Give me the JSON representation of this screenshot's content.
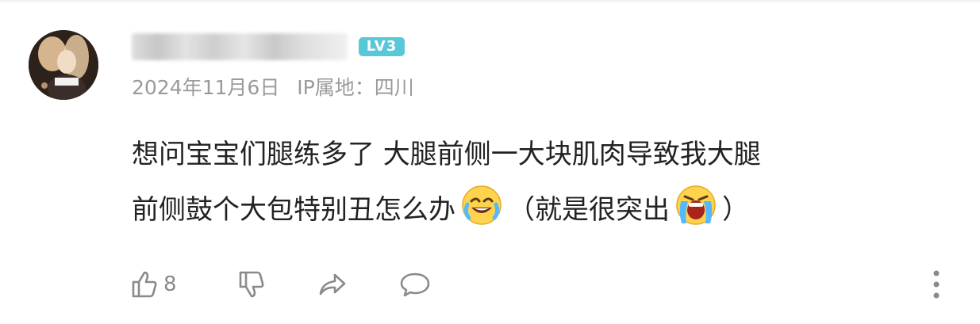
{
  "comment": {
    "user": {
      "level_badge": "LV3"
    },
    "meta": {
      "date": "2024年11月6日",
      "location": "IP属地：四川"
    },
    "text": {
      "line1": "想问宝宝们腿练多了 大腿前侧一大块肌肉导致我大腿",
      "line2_part1": "前侧鼓个大包特别丑怎么办",
      "line2_part2": "（就是很突出",
      "line2_part3": "）"
    },
    "actions": {
      "like_count": "8"
    }
  },
  "colors": {
    "level_badge_bg": "#58c8d8",
    "meta_text": "#9a9a9a",
    "body_text": "#222222",
    "icon_gray": "#8a8a8a"
  },
  "icons": {
    "emoji1": "laughing-crying-face-icon",
    "emoji2": "loudly-crying-face-icon",
    "like": "thumbs-up-icon",
    "dislike": "thumbs-down-icon",
    "share": "share-arrow-icon",
    "comment": "speech-bubble-icon",
    "more": "more-vertical-icon"
  }
}
